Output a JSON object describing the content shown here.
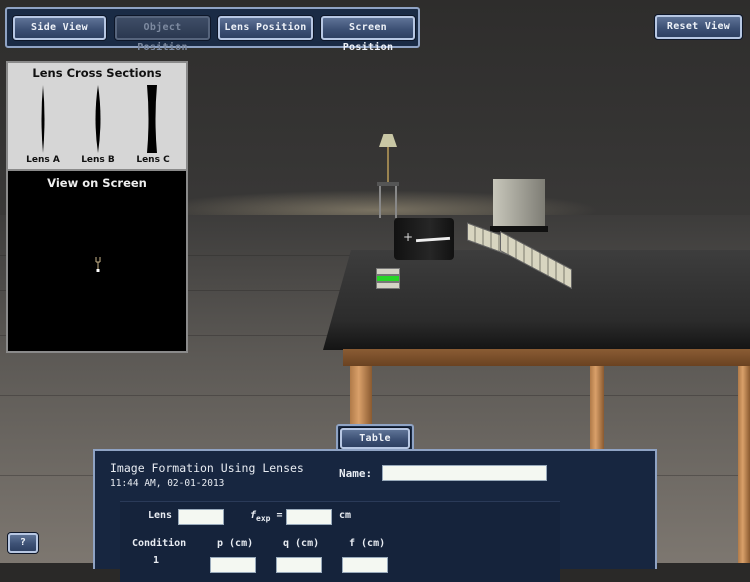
{
  "toolbar": {
    "buttons": [
      {
        "label": "Side View",
        "enabled": true
      },
      {
        "label": "Object Position",
        "enabled": false
      },
      {
        "label": "Lens Position",
        "enabled": true
      },
      {
        "label": "Screen Position",
        "enabled": true
      }
    ],
    "reset_label": "Reset View"
  },
  "lens_panel": {
    "title": "Lens Cross Sections",
    "lenses": [
      {
        "label": "Lens A",
        "shape": "thin-convex"
      },
      {
        "label": "Lens B",
        "shape": "convex"
      },
      {
        "label": "Lens C",
        "shape": "concave"
      }
    ]
  },
  "view_panel": {
    "title": "View on Screen"
  },
  "table_tab": {
    "label": "Table"
  },
  "data_panel": {
    "title": "Image Formation Using Lenses",
    "datetime": "11:44 AM, 02-01-2013",
    "name_label": "Name:",
    "name_value": "",
    "lens_label": "Lens",
    "lens_value": "",
    "fexp_label": "f",
    "fexp_sub": "exp",
    "fexp_eq": "=",
    "fexp_value": "",
    "fexp_unit": "cm",
    "columns": [
      "Condition",
      "p (cm)",
      "q (cm)",
      "f (cm)"
    ],
    "rows": [
      {
        "condition": "1",
        "p": "",
        "q": "",
        "f": ""
      }
    ]
  },
  "help": {
    "label": "?"
  }
}
